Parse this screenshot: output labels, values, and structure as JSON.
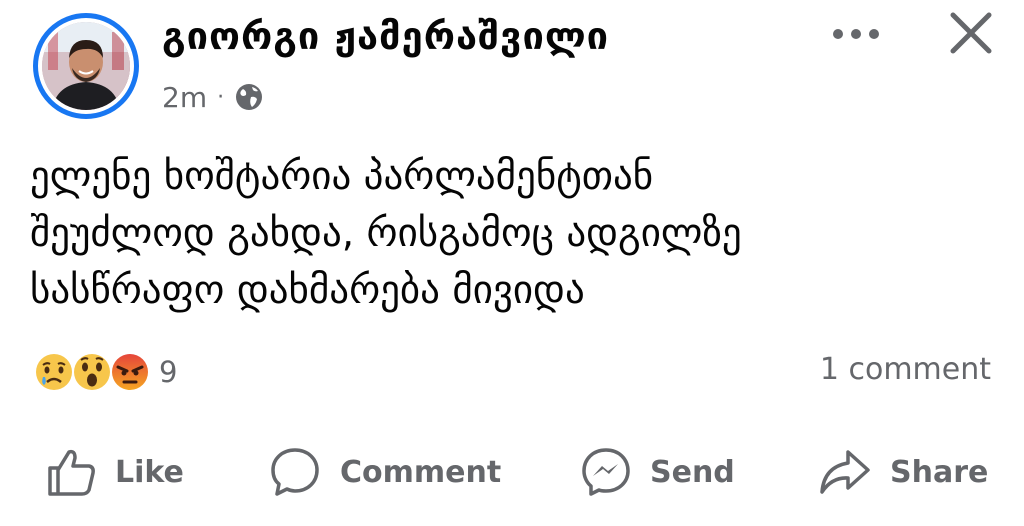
{
  "post": {
    "author": "გიორგი ჟამერაშვილი",
    "time": "2m",
    "separator": "·",
    "privacy_icon": "globe-icon",
    "text": "ელენე ხოშტარია პარლამენტთან\nშეუძლოდ გახდა, რისგამოც ადგილზე\nსასწრაფო დახმარება მივიდა"
  },
  "header_icons": [
    "more-options-icon",
    "close-icon"
  ],
  "reactions": {
    "types": [
      "sad",
      "wow",
      "angry"
    ],
    "count": "9"
  },
  "comments": {
    "label": "1 comment"
  },
  "actions": {
    "like": "Like",
    "comment": "Comment",
    "send": "Send",
    "share": "Share"
  },
  "colors": {
    "accent": "#1877f2",
    "secondary_text": "#65676b",
    "primary_text": "#050505"
  }
}
